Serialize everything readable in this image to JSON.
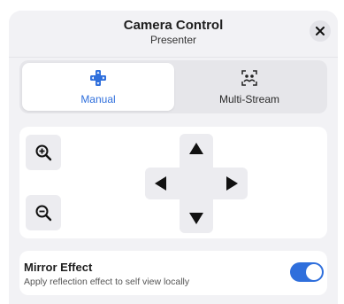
{
  "header": {
    "title": "Camera Control",
    "subtitle": "Presenter",
    "close_icon": "close-icon"
  },
  "tabs": [
    {
      "label": "Manual",
      "icon": "dpad-icon",
      "active": true
    },
    {
      "label": "Multi-Stream",
      "icon": "multi-user-focus-icon",
      "active": false
    }
  ],
  "controls": {
    "zoom_in_icon": "zoom-in-icon",
    "zoom_out_icon": "zoom-out-icon",
    "dpad": [
      "arrow-up-icon",
      "arrow-down-icon",
      "arrow-left-icon",
      "arrow-right-icon"
    ]
  },
  "mirror": {
    "title": "Mirror Effect",
    "description": "Apply reflection effect to self view locally",
    "enabled": true
  },
  "colors": {
    "accent": "#2f6fdc",
    "panel_bg": "#f2f2f5",
    "button_bg": "#ececf0"
  }
}
